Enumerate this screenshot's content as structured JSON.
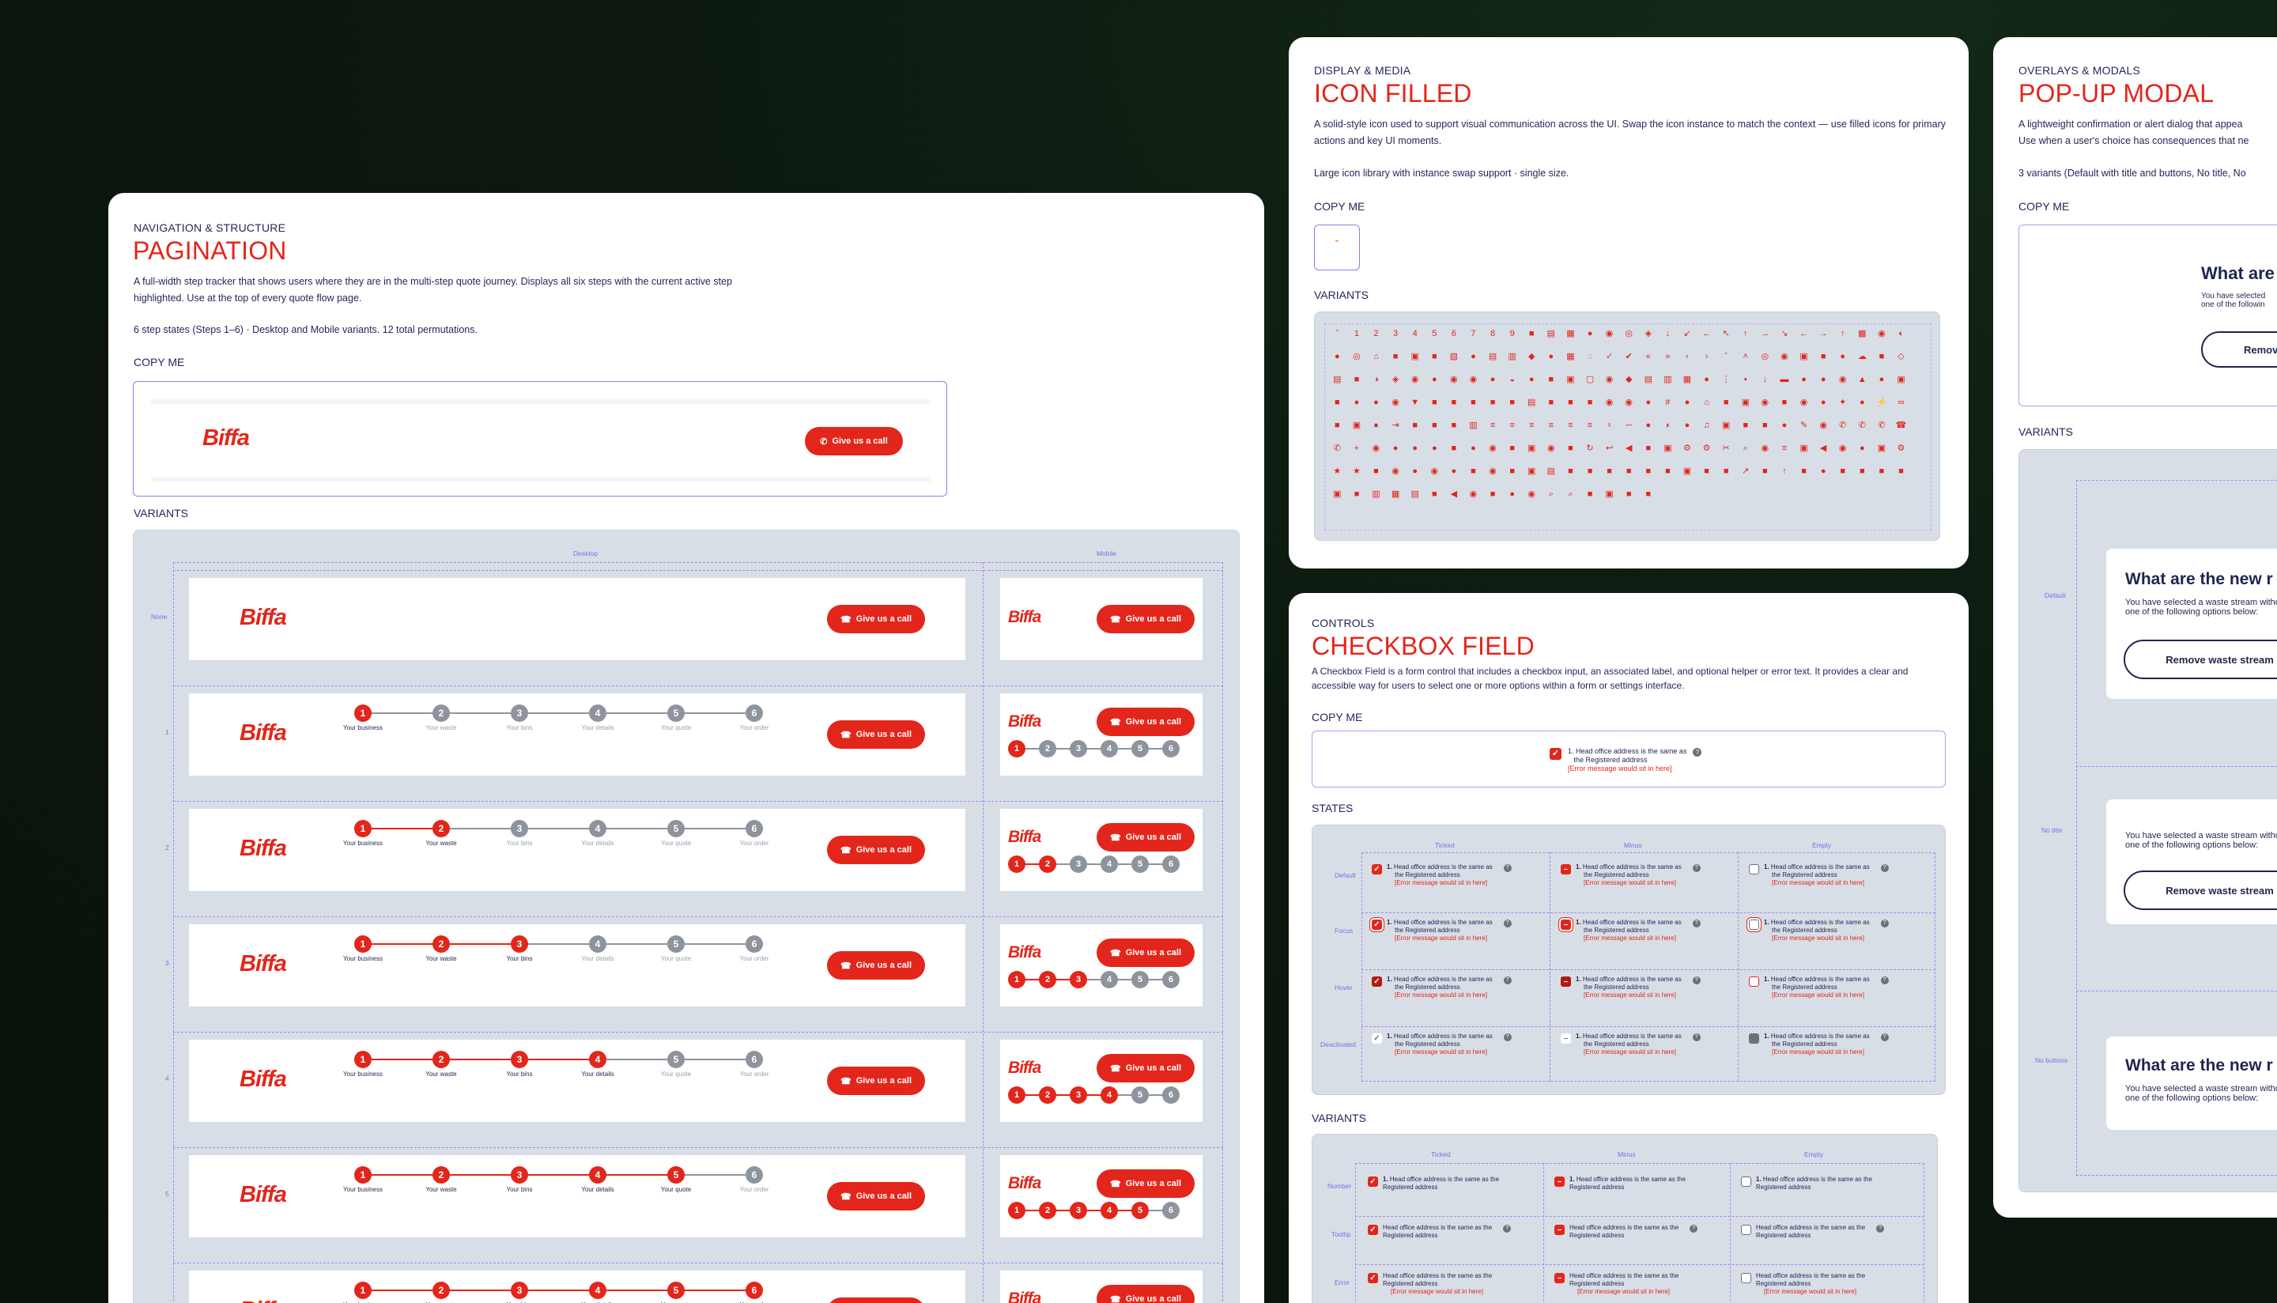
{
  "colors": {
    "accent": "#e3261b",
    "navy": "#1f2550",
    "inactive": "#8e949d",
    "background": "#0c180f"
  },
  "pagination": {
    "category": "NAVIGATION & STRUCTURE",
    "title": "PAGINATION",
    "description": "A full-width step tracker that shows users where they are in the multi-step quote journey. Displays all six steps with the current active step highlighted. Use at the top of every quote flow page.",
    "note": "6 step states (Steps 1–6) · Desktop and Mobile variants. 12 total permutations.",
    "copy_label": "COPY ME",
    "variants_label": "VARIANTS",
    "logo": "Biffa",
    "cta": "Give us a call",
    "col_desktop": "Desktop",
    "col_mobile": "Mobile",
    "row_labels": [
      "None",
      "1",
      "2",
      "3",
      "4",
      "5"
    ],
    "steps": [
      "Your business",
      "Your waste",
      "Your bins",
      "Your details",
      "Your quote",
      "Your order"
    ],
    "step_numbers": [
      "1",
      "2",
      "3",
      "4",
      "5",
      "6"
    ]
  },
  "icon_filled": {
    "category": "DISPLAY & MEDIA",
    "title": "ICON FILLED",
    "description": "A solid-style icon used to support visual communication across the UI. Swap the icon instance to match the context — use filled icons for primary actions and key UI moments.",
    "note": "Large icon library with instance swap support · single size.",
    "copy_label": "COPY ME",
    "copy_icon": "chevron-down-icon",
    "variants_label": "VARIANTS"
  },
  "checkbox_field": {
    "category": "CONTROLS",
    "title": "CHECKBOX FIELD",
    "description": "A Checkbox Field is a form control that includes a checkbox input, an associated label, and optional helper or error text. It provides a clear and accessible way for users to select one or more options within a form or settings interface.",
    "copy_label": "COPY ME",
    "states_label": "STATES",
    "variants_label": "VARIANTS",
    "number": "1.",
    "label_line1": "Head office address is the same as",
    "label_line2": "the Registered address",
    "label_oneline": "Head office address is the same as the",
    "label_tail": "Registered address",
    "error": "[Error message would sit in here]",
    "cols": [
      "Ticked",
      "Minus",
      "Empty"
    ],
    "state_rows": [
      "Default",
      "Focus",
      "Hover",
      "Deactivated"
    ],
    "variant_rows": [
      "Number",
      "Tooltip",
      "Error"
    ]
  },
  "popup_modal": {
    "category": "OVERLAYS & MODALS",
    "title": "POP-UP MODAL",
    "description_line1": "A lightweight confirmation or alert dialog that appea",
    "description_line2": "Use when a user's choice has consequences that ne",
    "note": "3 variants (Default with title and buttons, No title, No",
    "copy_label": "COPY ME",
    "variants_label": "VARIANTS",
    "copy_title": "What are",
    "copy_text_line1": "You have selected",
    "copy_text_line2": "one of the followin",
    "copy_button": "Remove",
    "variant_title": "What are the new r",
    "text_line1": "You have selected a waste stream witho",
    "text_line2": "one of the following options below:",
    "button": "Remove waste stream",
    "row_labels": [
      "Default",
      "No title",
      "No buttons"
    ]
  }
}
